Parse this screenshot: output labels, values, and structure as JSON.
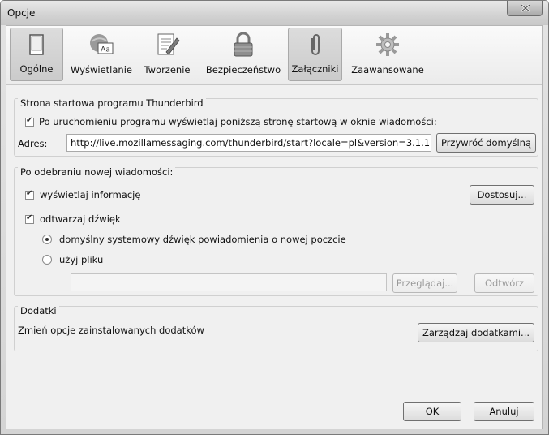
{
  "window": {
    "title": "Opcje"
  },
  "toolbar": {
    "tabs": [
      {
        "label": "Ogólne",
        "icon": "general-window-icon"
      },
      {
        "label": "Wyświetlanie",
        "icon": "display-fonts-icon"
      },
      {
        "label": "Tworzenie",
        "icon": "compose-pencil-icon"
      },
      {
        "label": "Bezpieczeństwo",
        "icon": "padlock-icon"
      },
      {
        "label": "Załączniki",
        "icon": "paperclip-icon"
      },
      {
        "label": "Zaawansowane",
        "icon": "gear-icon"
      }
    ]
  },
  "startpage": {
    "caption": "Strona startowa programu Thunderbird",
    "checkbox_label": "Po uruchomieniu programu wyświetlaj poniższą stronę startową w oknie wiadomości:",
    "checkbox_checked": true,
    "address_label": "Adres:",
    "address_value": "http://live.mozillamessaging.com/thunderbird/start?locale=pl&version=3.1.1",
    "restore_button": "Przywróć domyślną"
  },
  "newmail": {
    "caption": "Po odebraniu nowej wiadomości:",
    "show_info_label": "wyświetlaj informację",
    "show_info_checked": true,
    "customize_button": "Dostosuj...",
    "play_sound_label": "odtwarzaj dźwięk",
    "play_sound_checked": true,
    "radio_default_label": "domyślny systemowy dźwięk powiadomienia o nowej poczcie",
    "radio_file_label": "użyj pliku",
    "selected_radio": "default",
    "file_value": "",
    "browse_button": "Przeglądaj...",
    "play_button": "Odtwórz"
  },
  "addons": {
    "caption": "Dodatki",
    "description": "Zmień opcje zainstalowanych dodatków",
    "manage_button": "Zarządzaj dodatkami..."
  },
  "footer": {
    "ok_button": "OK",
    "cancel_button": "Anuluj"
  }
}
